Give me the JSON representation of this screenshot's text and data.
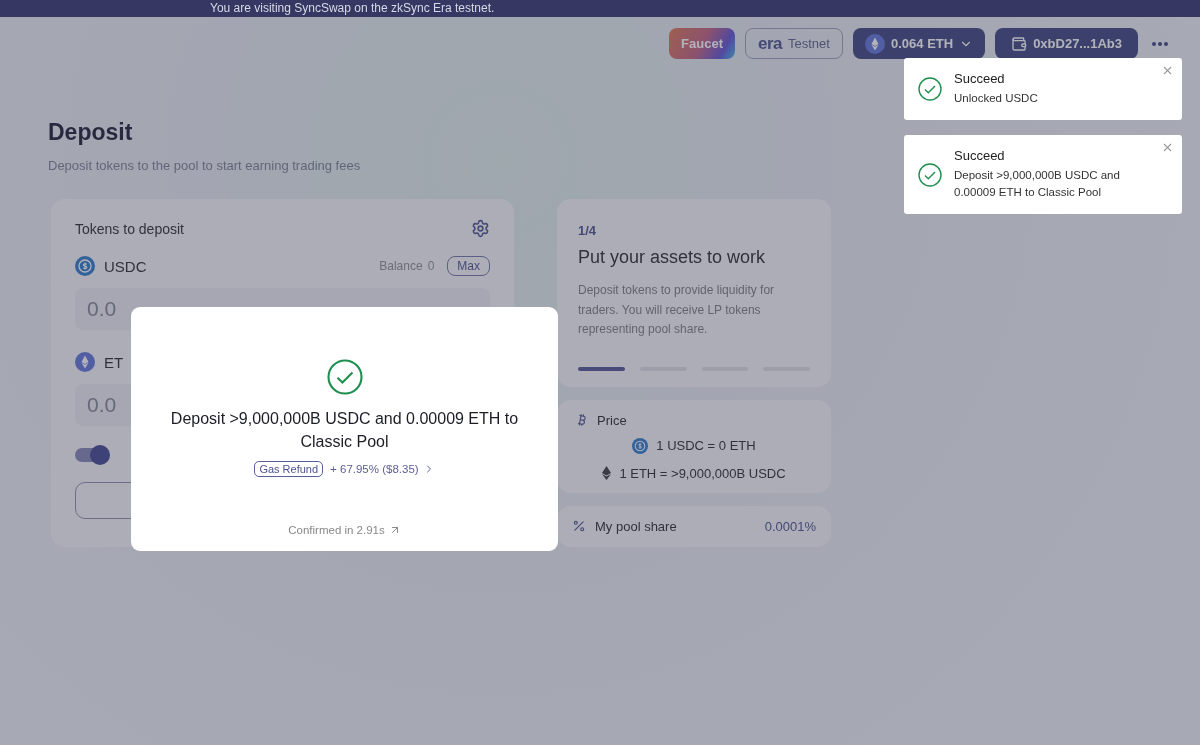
{
  "banner": "You are visiting SyncSwap on the zkSync Era testnet.",
  "header": {
    "faucet": "Faucet",
    "network_logo": "era",
    "network": "Testnet",
    "balance": "0.064",
    "balance_unit": "ETH",
    "wallet": "0xbD27...1Ab3"
  },
  "page": {
    "title": "Deposit",
    "subtitle": "Deposit tokens to the pool to start earning trading fees"
  },
  "deposit_card": {
    "title": "Tokens to deposit",
    "tokens": [
      {
        "symbol": "USDC",
        "kind": "usdc",
        "balance_label": "Balance",
        "balance": "0",
        "max": "Max",
        "placeholder": "0.0"
      },
      {
        "symbol": "ET",
        "kind": "eth",
        "placeholder": "0.0"
      }
    ],
    "toggle": {
      "on": true
    }
  },
  "info_card": {
    "step": "1/4",
    "title": "Put your assets to work",
    "text": "Deposit tokens to provide liquidity for traders. You will receive LP tokens representing pool share.",
    "steps": [
      {
        "selected": true
      },
      {
        "selected": false
      },
      {
        "selected": false
      },
      {
        "selected": false
      }
    ]
  },
  "price_card": {
    "title": "Price",
    "rates": [
      {
        "kind": "usdc",
        "text": "1 USDC = 0 ETH"
      },
      {
        "kind": "eth",
        "text": "1 ETH = >9,000,000B USDC"
      }
    ]
  },
  "share_card": {
    "label": "My pool share",
    "value": "0.0001%"
  },
  "modal": {
    "message": "Deposit >9,000,000B USDC and 0.00009 ETH to Classic Pool",
    "badge": "Gas Refund",
    "refund": "+ 67.95% ($8.35)",
    "confirmed": "Confirmed in 2.91s"
  },
  "toasts": [
    {
      "title": "Succeed",
      "text": "Unlocked USDC"
    },
    {
      "title": "Succeed",
      "text": "Deposit >9,000,000B USDC and 0.00009 ETH to Classic Pool"
    }
  ]
}
